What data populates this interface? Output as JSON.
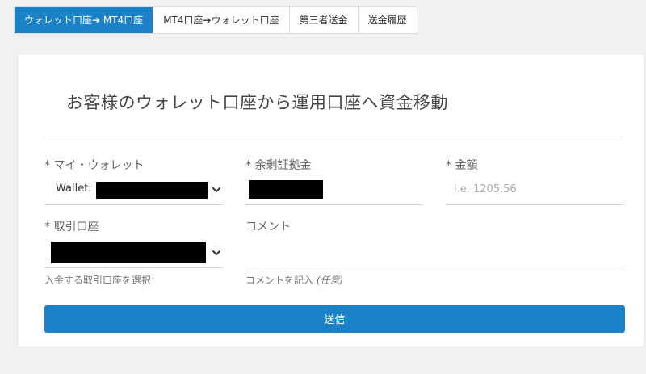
{
  "tabs": [
    {
      "label": "ウォレット口座➔ MT4口座"
    },
    {
      "label": "MT4口座➔ウォレット口座"
    },
    {
      "label": "第三者送金"
    },
    {
      "label": "送金履歴"
    }
  ],
  "form": {
    "title": "お客様のウォレット口座から運用口座へ資金移動",
    "wallet": {
      "label": "* マイ・ウォレット",
      "value_prefix": "Wallet:"
    },
    "balance": {
      "label": "* 余剰証拠金"
    },
    "amount": {
      "label": "* 金額",
      "placeholder": "i.e. 1205.56"
    },
    "trading_account": {
      "label": "* 取引口座",
      "help": "入金する取引口座を選択"
    },
    "comment": {
      "label": "コメント",
      "help": "コメントを記入",
      "help_optional": "(任意)"
    },
    "submit_label": "送信"
  },
  "colors": {
    "accent": "#1b82c8",
    "background": "#f1f1f2",
    "redaction": "#000000"
  },
  "icons": {
    "select_arrow": "chevron-down-icon"
  }
}
